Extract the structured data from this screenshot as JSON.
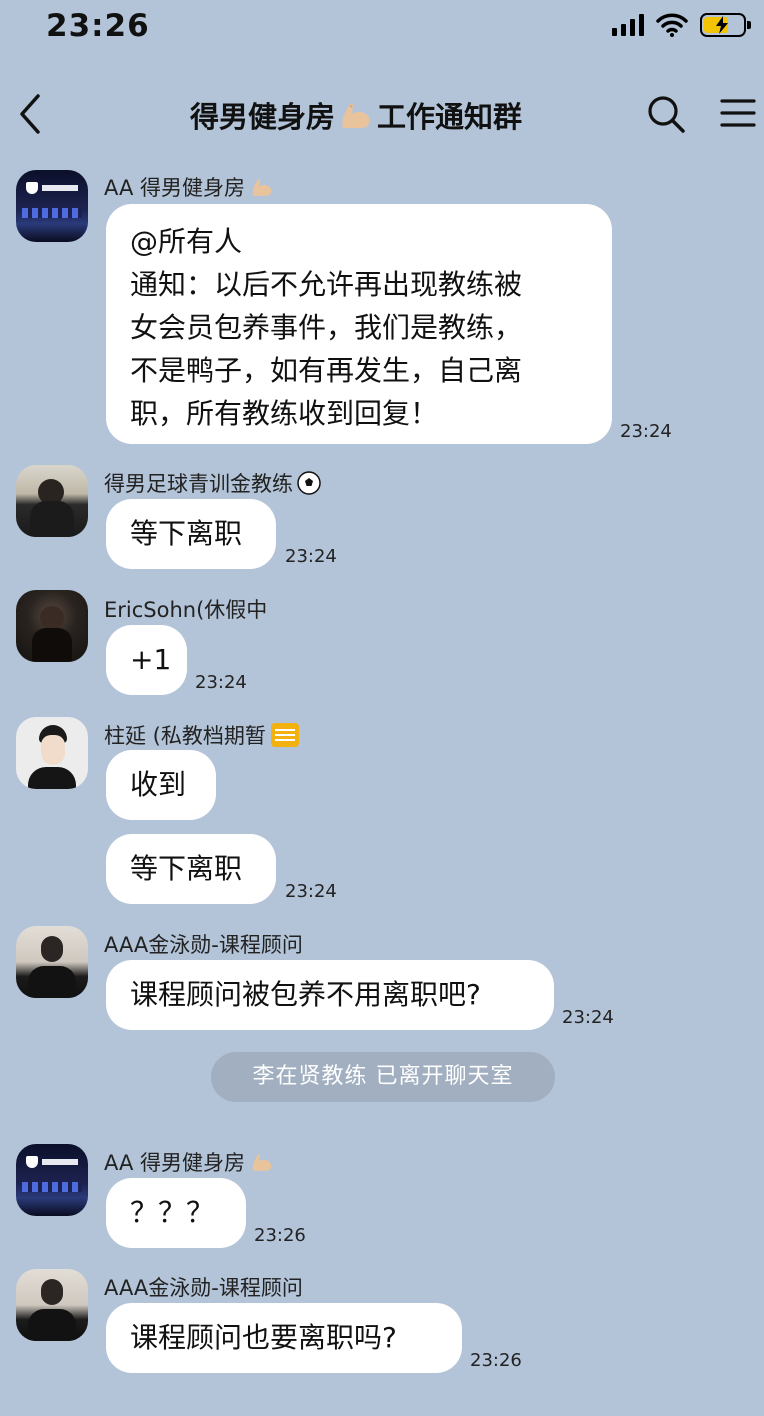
{
  "status_bar": {
    "time": "23:26"
  },
  "header": {
    "title_left": "得男健身房",
    "title_right": "工作通知群"
  },
  "messages": [
    {
      "sender": "AA 得男健身房",
      "lines": [
        "@所有人",
        "通知：以后不允许再出现教练被",
        "女会员包养事件，我们是教练，",
        "不是鸭子，如有再发生，自己离",
        "职，所有教练收到回复！"
      ],
      "time": "23:24"
    },
    {
      "sender": "得男足球青训金教练",
      "text": "等下离职",
      "time": "23:24"
    },
    {
      "sender": "EricSohn(休假中",
      "text": "+1",
      "time": "23:24"
    },
    {
      "sender": "柱延 (私教档期暂",
      "text": "收到",
      "text2": "等下离职",
      "time": "23:24"
    },
    {
      "sender": "AAA金泳勋-课程顾问",
      "text": "课程顾问被包养不用离职吧?",
      "time": "23:24"
    },
    {
      "sender": "AA 得男健身房",
      "text": "？？？",
      "time": "23:26"
    },
    {
      "sender": "AAA金泳勋-课程顾问",
      "text": "课程顾问也要离职吗?",
      "time": "23:26"
    }
  ],
  "system_notice": "李在贤教练  已离开聊天室",
  "colors": {
    "background": "#b3c4d8",
    "bubble": "#ffffff",
    "notice_bg": "#a1afc0",
    "battery": "#f2c400"
  }
}
